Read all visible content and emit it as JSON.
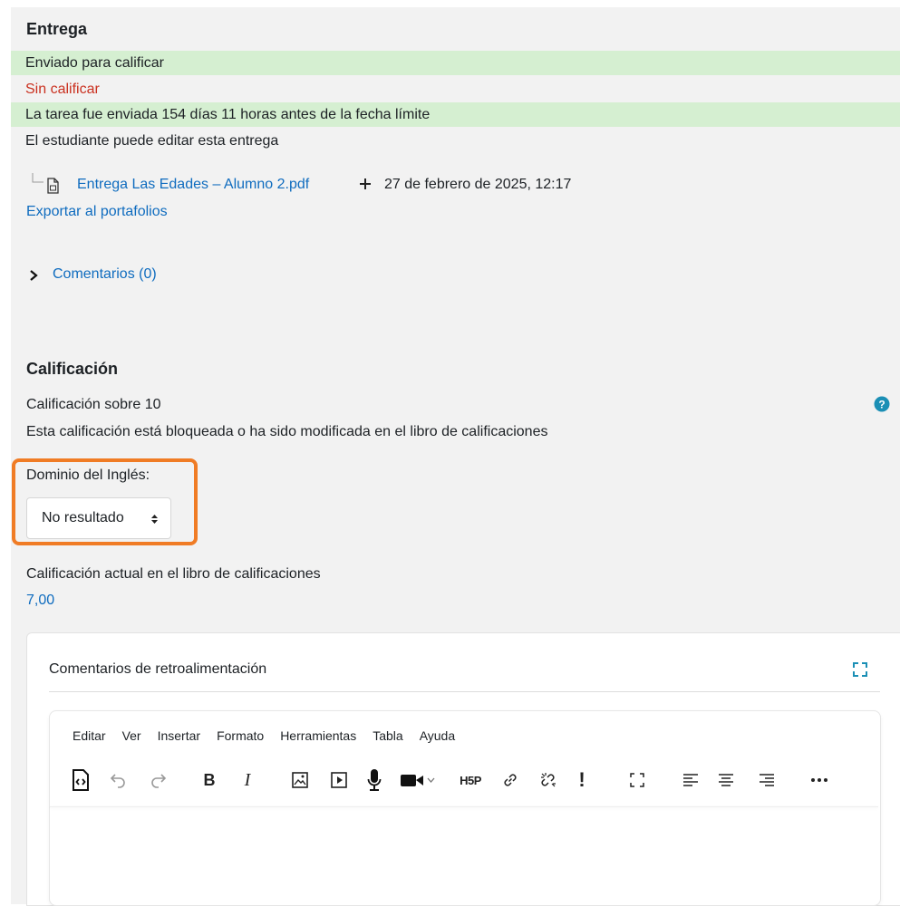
{
  "submission": {
    "heading": "Entrega",
    "status_submitted": "Enviado para calificar",
    "status_grading": "Sin calificar",
    "time_remaining": "La tarea fue enviada 154 días 11 horas antes de la fecha límite",
    "edit_status": "El estudiante puede editar esta entrega",
    "file_name": "Entrega Las Edades – Alumno 2.pdf",
    "file_date": "27 de febrero de 2025, 12:17",
    "export_link": "Exportar al portafolios",
    "comments_link": "Comentarios (0)"
  },
  "grade": {
    "heading": "Calificación",
    "grade_out_of": "Calificación sobre 10",
    "locked_note": "Esta calificación está bloqueada o ha sido modificada en el libro de calificaciones",
    "outcome_label": "Dominio del Inglés:",
    "outcome_selected": "No resultado",
    "current_label": "Calificación actual en el libro de calificaciones",
    "current_value": "7,00"
  },
  "feedback": {
    "label": "Comentarios de retroalimentación",
    "menu": [
      "Editar",
      "Ver",
      "Insertar",
      "Formato",
      "Herramientas",
      "Tabla",
      "Ayuda"
    ],
    "toolbar_icons": [
      "source-code-icon",
      "undo-icon",
      "redo-icon",
      "bold-icon",
      "italic-icon",
      "image-icon",
      "media-icon",
      "record-audio-icon",
      "record-video-icon",
      "h5p-icon",
      "link-icon",
      "unlink-icon",
      "exclamation-icon",
      "fullscreen-icon",
      "align-left-icon",
      "align-center-icon",
      "align-right-icon",
      "more-icon"
    ]
  },
  "colors": {
    "link": "#0f6cbf",
    "success_bg": "#d5efd1",
    "danger_text": "#ca3120",
    "highlight_border": "#f07c25",
    "help_icon": "#1b8fb5"
  }
}
